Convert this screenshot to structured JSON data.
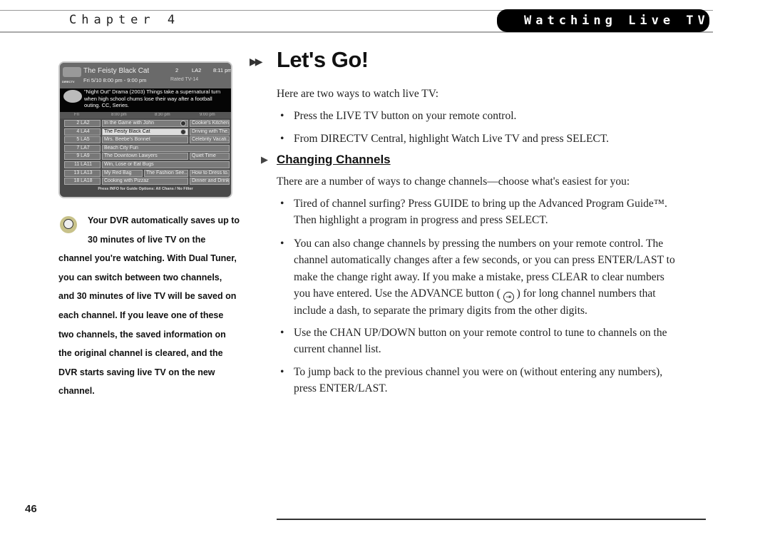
{
  "header": {
    "chapter": "Chapter 4",
    "section": "Watching Live TV"
  },
  "guide": {
    "program_title": "The Feisty Black Cat",
    "airtime": "Fri 5/10 8:00 pm - 9:00 pm",
    "channel_number": "2",
    "channel_name": "LA2",
    "clock": "8:11 pm",
    "rating": "Rated TV-14",
    "brand": "DIRECTV",
    "description_lines": [
      "\"Night Out\" Drama (2003) Things take a supernatural turn",
      "when high school chums lose their way after a football",
      "outing. CC, Series."
    ],
    "day": "Fri",
    "times": [
      "8:00 pm",
      "8:30 pm",
      "9:00 pm"
    ],
    "rows": [
      {
        "channel": "2 LA2",
        "programs": [
          {
            "title": "In the Game with John",
            "slots": [
              0,
              2
            ],
            "record": true
          },
          {
            "title": "Cookie's Kitchen",
            "slots": [
              2,
              3
            ]
          }
        ]
      },
      {
        "channel": "4 LA4",
        "programs": [
          {
            "title": "The Feisty Black Cat",
            "slots": [
              0,
              2
            ],
            "record": true,
            "highlighted": true
          },
          {
            "title": "Driving with The...",
            "slots": [
              2,
              3
            ]
          }
        ]
      },
      {
        "channel": "5 LA5",
        "programs": [
          {
            "title": "Mrs. Beebe's Bonnet",
            "slots": [
              0,
              2
            ]
          },
          {
            "title": "Celebrity Vacati...",
            "slots": [
              2,
              3
            ]
          }
        ]
      },
      {
        "channel": "7 LA7",
        "programs": [
          {
            "title": "Beach City Fun",
            "slots": [
              0,
              3
            ]
          }
        ]
      },
      {
        "channel": "9 LA9",
        "programs": [
          {
            "title": "The Downtown Lawyers",
            "slots": [
              0,
              2
            ]
          },
          {
            "title": "Quiet Time",
            "slots": [
              2,
              3
            ]
          }
        ]
      },
      {
        "channel": "11 LA11",
        "programs": [
          {
            "title": "Win, Lose or Eat Bugs",
            "slots": [
              0,
              3
            ]
          }
        ]
      },
      {
        "channel": "13 LA13",
        "programs": [
          {
            "title": "My Red Bag",
            "slots": [
              0,
              1
            ]
          },
          {
            "title": "The Fashion See...",
            "slots": [
              1,
              2
            ]
          },
          {
            "title": "How to Dress to...",
            "slots": [
              2,
              3
            ]
          }
        ]
      },
      {
        "channel": "18 LA18",
        "programs": [
          {
            "title": "Cooking with Pizzaz",
            "slots": [
              0,
              2
            ]
          },
          {
            "title": "Dinner and Drinks",
            "slots": [
              2,
              3
            ]
          }
        ]
      }
    ],
    "footer": "Press INFO for Guide Options:    All Chans / No Filter"
  },
  "note": {
    "icon": "satellite-dish-icon",
    "lines": [
      "Your DVR automatically saves up to",
      "30 minutes of live TV on the",
      "channel you're watching. With Dual Tuner,",
      "you can switch between two channels,",
      "and 30 minutes of live TV will be saved on",
      "each channel. If you leave one of these",
      "two channels, the saved information on",
      "the original channel is cleared, and the",
      "DVR starts saving live TV on the new",
      "channel."
    ]
  },
  "main": {
    "title": "Let's Go!",
    "intro": "Here are two ways to watch live TV:",
    "bullets1": [
      "Press the LIVE TV button on your remote control.",
      "From DIRECTV Central, highlight Watch Live TV and press SELECT."
    ],
    "subhead": "Changing Channels",
    "intro2": "There are a number of ways to change channels—choose what's easiest for you:",
    "b1_lines": [
      "Tired of channel surfing? Press GUIDE to bring up the Advanced Program Guide™.",
      "Then highlight a program in progress and press SELECT."
    ],
    "b2_lines": [
      "You can also change channels by pressing the numbers on your remote control. The",
      "channel automatically changes after a few seconds, or you can press ENTER/LAST to",
      "make the change right away. If you make a mistake, press CLEAR to clear numbers"
    ],
    "b2_adv_pre": "you have entered. Use the ADVANCE button (",
    "b2_adv_post": ") for long channel numbers that",
    "b2_last": "include a dash, to separate the primary digits from the other digits.",
    "b3_lines": [
      "Use the CHAN UP/DOWN button on your remote control to tune to channels on the",
      "current channel list."
    ],
    "b4_lines": [
      "To jump back to the previous channel you were on (without entering any numbers),",
      "press ENTER/LAST."
    ]
  },
  "page_number": "46"
}
